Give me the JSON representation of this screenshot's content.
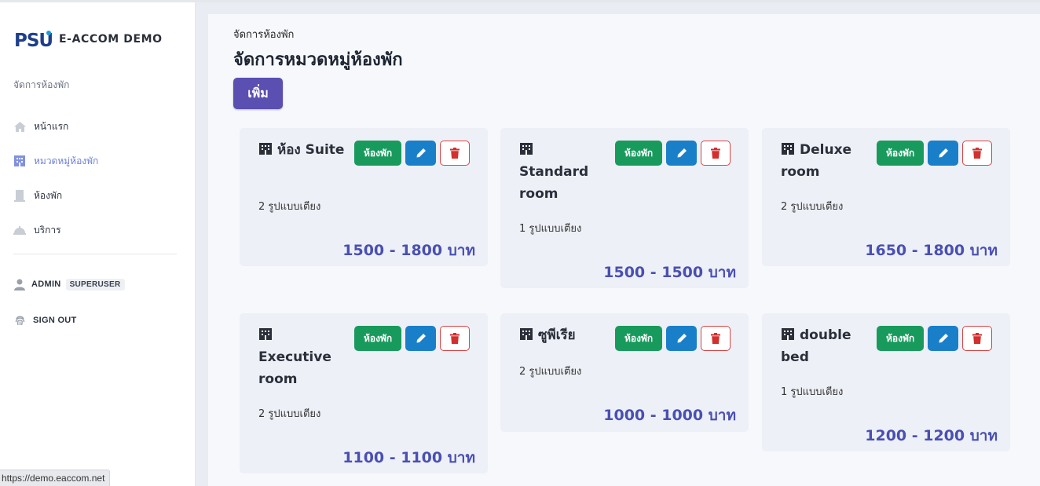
{
  "brand": {
    "name": "E-ACCOM DEMO"
  },
  "sidebar": {
    "section_label": "จัดการห้องพัก",
    "items": [
      {
        "label": "หน้าแรก",
        "icon": "home-icon"
      },
      {
        "label": "หมวดหมู่ห้องพัก",
        "icon": "building-icon"
      },
      {
        "label": "ห้องพัก",
        "icon": "door-icon"
      },
      {
        "label": "บริการ",
        "icon": "service-bell-icon"
      }
    ],
    "user": {
      "name": "ADMIN",
      "role": "SUPERUSER"
    },
    "signout": "SIGN OUT"
  },
  "status_url": "https://demo.eaccom.net",
  "main": {
    "breadcrumb": "จัดการห้องพัก",
    "title": "จัดการหมวดหมู่ห้องพัก",
    "add_label": "เพิ่ม",
    "cards": [
      {
        "name": "ห้อง Suite",
        "beds": "2 รูปแบบเตียง",
        "price": "1500 - 1800 บาท",
        "room_btn": "ห้องพัก"
      },
      {
        "name": "Standard room",
        "beds": "1 รูปแบบเตียง",
        "price": "1500 - 1500 บาท",
        "room_btn": "ห้องพัก"
      },
      {
        "name": "Deluxe room",
        "beds": "2 รูปแบบเตียง",
        "price": "1650 - 1800 บาท",
        "room_btn": "ห้องพัก"
      },
      {
        "name": "Executive room",
        "beds": "2 รูปแบบเตียง",
        "price": "1100 - 1100 บาท",
        "room_btn": "ห้องพัก"
      },
      {
        "name": "ซูพีเรีย",
        "beds": "2 รูปแบบเตียง",
        "price": "1000 - 1000 บาท",
        "room_btn": "ห้องพัก"
      },
      {
        "name": "double bed",
        "beds": "1 รูปแบบเตียง",
        "price": "1200 - 1200 บาท",
        "room_btn": "ห้องพัก"
      }
    ]
  },
  "colors": {
    "accent": "#5b4fb2",
    "success": "#199a5d",
    "info": "#1a7fc9",
    "danger": "#d84646",
    "price": "#4a4fb3"
  }
}
